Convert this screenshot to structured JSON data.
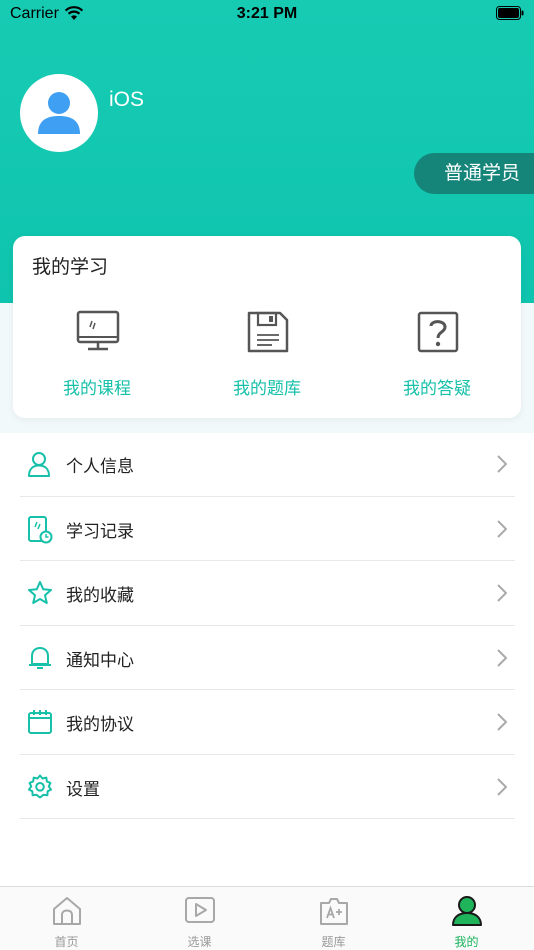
{
  "status_bar": {
    "carrier": "Carrier",
    "time": "3:21 PM"
  },
  "profile": {
    "username": "iOS",
    "role": "普通学员"
  },
  "study": {
    "title": "我的学习",
    "items": [
      {
        "label": "我的课程",
        "icon": "monitor-icon"
      },
      {
        "label": "我的题库",
        "icon": "floppy-disk-icon"
      },
      {
        "label": "我的答疑",
        "icon": "question-icon"
      }
    ]
  },
  "menu": {
    "items": [
      {
        "label": "个人信息",
        "icon": "person-icon"
      },
      {
        "label": "学习记录",
        "icon": "tablet-clock-icon"
      },
      {
        "label": "我的收藏",
        "icon": "star-icon"
      },
      {
        "label": "通知中心",
        "icon": "bell-icon"
      },
      {
        "label": "我的协议",
        "icon": "calendar-icon"
      },
      {
        "label": "设置",
        "icon": "gear-icon"
      }
    ]
  },
  "tabbar": {
    "items": [
      {
        "label": "首页",
        "icon": "home-icon"
      },
      {
        "label": "选课",
        "icon": "play-icon"
      },
      {
        "label": "题库",
        "icon": "grade-icon"
      },
      {
        "label": "我的",
        "icon": "user-icon",
        "active": true
      }
    ]
  },
  "colors": {
    "accent": "#16c0a9",
    "header": "#17cbb3",
    "badge": "#15857a",
    "tab_active": "#18b35a"
  }
}
